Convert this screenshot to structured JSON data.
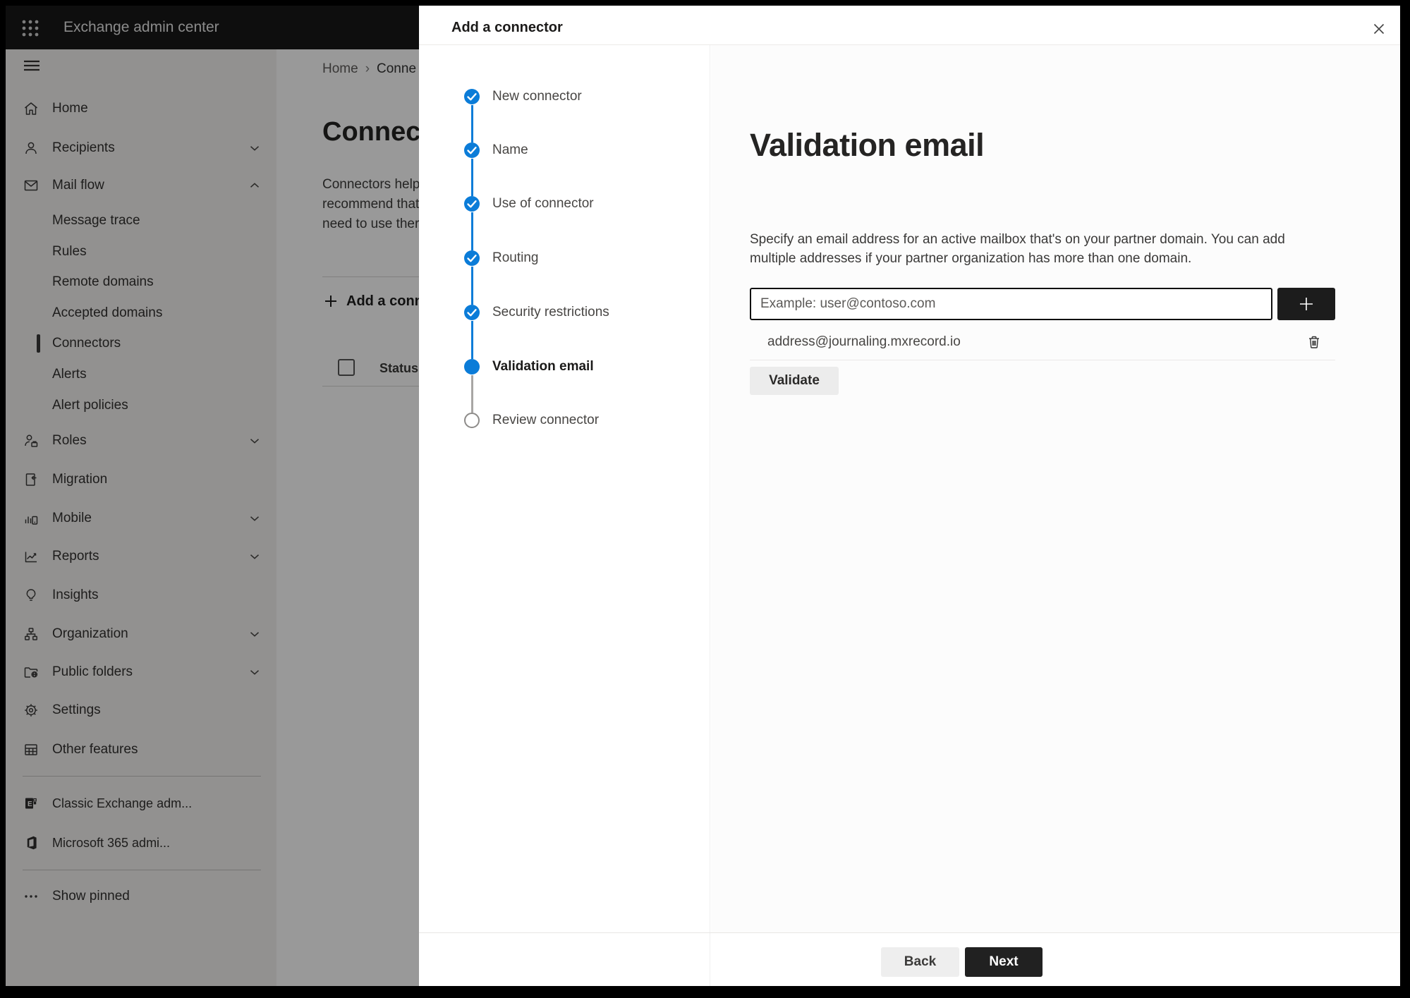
{
  "topbar": {
    "title": "Exchange admin center"
  },
  "sidebar": {
    "items": [
      {
        "label": "Home"
      },
      {
        "label": "Recipients"
      },
      {
        "label": "Mail flow"
      },
      {
        "label": "Message trace"
      },
      {
        "label": "Rules"
      },
      {
        "label": "Remote domains"
      },
      {
        "label": "Accepted domains"
      },
      {
        "label": "Connectors"
      },
      {
        "label": "Alerts"
      },
      {
        "label": "Alert policies"
      },
      {
        "label": "Roles"
      },
      {
        "label": "Migration"
      },
      {
        "label": "Mobile"
      },
      {
        "label": "Reports"
      },
      {
        "label": "Insights"
      },
      {
        "label": "Organization"
      },
      {
        "label": "Public folders"
      },
      {
        "label": "Settings"
      },
      {
        "label": "Other features"
      },
      {
        "label": "Classic Exchange adm..."
      },
      {
        "label": "Microsoft 365 admi..."
      },
      {
        "label": "Show pinned"
      }
    ]
  },
  "main": {
    "breadcrumb": {
      "home": "Home",
      "separator": "›",
      "current": "Conne"
    },
    "heading": "Connec",
    "paragraph_lines": {
      "l1": "Connectors help",
      "l2": "recommend that",
      "l3": "need to use ther"
    },
    "add_button_label": "Add a conn",
    "status_header": "Status"
  },
  "panel": {
    "title": "Add a connector",
    "steps": [
      {
        "label": "New connector",
        "state": "completed"
      },
      {
        "label": "Name",
        "state": "completed"
      },
      {
        "label": "Use of connector",
        "state": "completed"
      },
      {
        "label": "Routing",
        "state": "completed"
      },
      {
        "label": "Security restrictions",
        "state": "completed"
      },
      {
        "label": "Validation email",
        "state": "current"
      },
      {
        "label": "Review connector",
        "state": "upcoming"
      }
    ],
    "content": {
      "heading": "Validation email",
      "description": "Specify an email address for an active mailbox that's on your partner domain. You can add multiple addresses if your partner organization has more than one domain.",
      "email_placeholder": "Example: user@contoso.com",
      "addresses": [
        {
          "email": "address@journaling.mxrecord.io"
        }
      ],
      "validate_label": "Validate"
    },
    "footer": {
      "back": "Back",
      "next": "Next"
    }
  },
  "colors": {
    "accent": "#0b7cd8",
    "dark_button": "#1c1c1c",
    "topbar_bg": "#181818",
    "sidebar_bg": "#f3f2f1"
  }
}
